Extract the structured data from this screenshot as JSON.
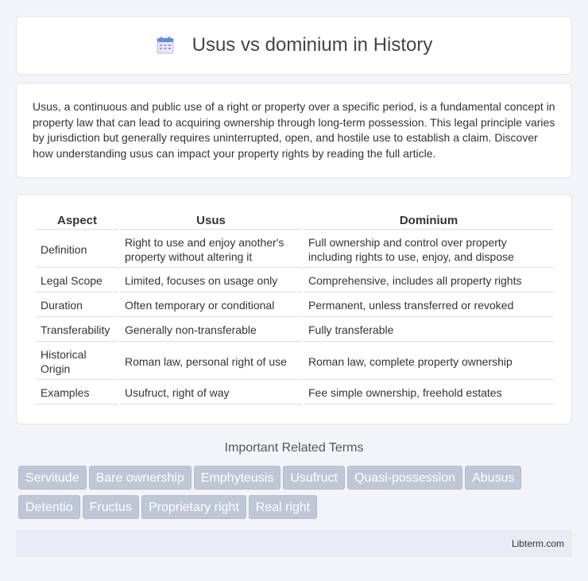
{
  "header": {
    "title": "Usus vs dominium in History",
    "icon": "calendar-icon"
  },
  "intro": "Usus, a continuous and public use of a right or property over a specific period, is a fundamental concept in property law that can lead to acquiring ownership through long-term possession. This legal principle varies by jurisdiction but generally requires uninterrupted, open, and hostile use to establish a claim. Discover how understanding usus can impact your property rights by reading the full article.",
  "table": {
    "headers": [
      "Aspect",
      "Usus",
      "Dominium"
    ],
    "rows": [
      [
        "Definition",
        "Right to use and enjoy another's property without altering it",
        "Full ownership and control over property including rights to use, enjoy, and dispose"
      ],
      [
        "Legal Scope",
        "Limited, focuses on usage only",
        "Comprehensive, includes all property rights"
      ],
      [
        "Duration",
        "Often temporary or conditional",
        "Permanent, unless transferred or revoked"
      ],
      [
        "Transferability",
        "Generally non-transferable",
        "Fully transferable"
      ],
      [
        "Historical Origin",
        "Roman law, personal right of use",
        "Roman law, complete property ownership"
      ],
      [
        "Examples",
        "Usufruct, right of way",
        "Fee simple ownership, freehold estates"
      ]
    ]
  },
  "related": {
    "title": "Important Related Terms",
    "tags": [
      "Servitude",
      "Bare ownership",
      "Emphyteusis",
      "Usufruct",
      "Quasi-possession",
      "Abusus",
      "Detentio",
      "Fructus",
      "Proprietary right",
      "Real right"
    ]
  },
  "footer": {
    "site": "Libterm.com"
  }
}
